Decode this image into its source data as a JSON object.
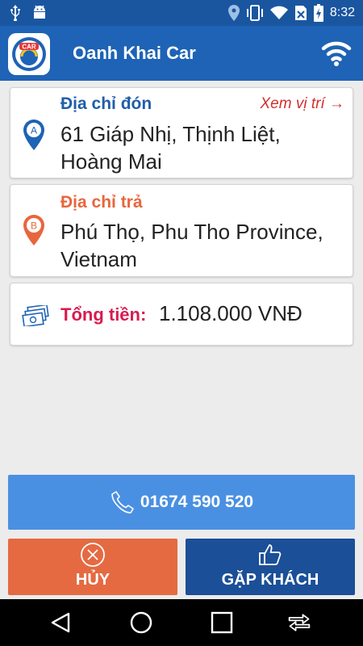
{
  "status_bar": {
    "time": "8:32",
    "left_icons": [
      "usb-icon",
      "android-icon"
    ],
    "right_icons": [
      "location-icon",
      "vibrate-icon",
      "wifi-icon",
      "no-sim-icon",
      "battery-charging-icon"
    ]
  },
  "app_bar": {
    "logo_text": "CAR",
    "title": "Oanh Khai Car"
  },
  "pickup": {
    "badge": "A",
    "label": "Địa chỉ đón",
    "address": "61 Giáp Nhị, Thịnh Liệt, Hoàng Mai",
    "view_location": "Xem vị trí →"
  },
  "dropoff": {
    "badge": "B",
    "label": "Địa chỉ trả",
    "address": "Phú Thọ, Phu Tho Province, Vietnam"
  },
  "total": {
    "label": "Tổng tiền:",
    "value": "1.108.000 VNĐ"
  },
  "call": {
    "number": "01674 590 520"
  },
  "actions": {
    "cancel_label": "HỦY",
    "meet_label": "GẶP KHÁCH"
  },
  "colors": {
    "primary": "#1e63b5",
    "status_bar": "#1a56a0",
    "pickup_label": "#1f5ea8",
    "dropoff_label": "#e8663d",
    "total_label": "#d81b4f",
    "view_location": "#d32f2f",
    "call_button": "#4a90e2",
    "cancel_button": "#e56a42",
    "meet_button": "#1b4f97"
  }
}
